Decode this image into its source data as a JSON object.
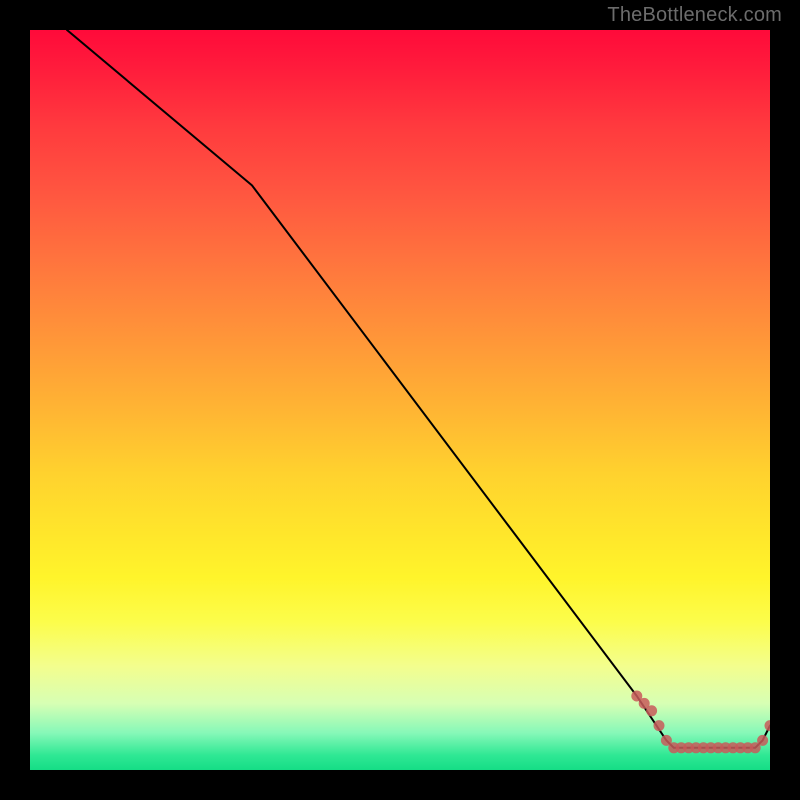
{
  "watermark": "TheBottleneck.com",
  "colors": {
    "bg": "#000000",
    "watermark": "#6c6c6c",
    "line": "#000000",
    "marker": "#c85a5a",
    "gradient_top": "#ff0a3a",
    "gradient_bottom": "#15dd86"
  },
  "chart_data": {
    "type": "line",
    "title": "",
    "xlabel": "",
    "ylabel": "",
    "xlim": [
      0,
      100
    ],
    "ylim": [
      0,
      100
    ],
    "grid": false,
    "legend": false,
    "series": [
      {
        "name": "curve",
        "x": [
          5,
          30,
          82,
          86,
          87,
          88,
          89,
          90,
          91,
          92,
          93,
          94,
          95,
          96,
          97,
          98,
          99,
          100
        ],
        "y": [
          100,
          79,
          10,
          4,
          3,
          3,
          3,
          3,
          3,
          3,
          3,
          3,
          3,
          3,
          3,
          3,
          4,
          6
        ]
      }
    ],
    "markers": {
      "name": "cluster",
      "x": [
        82,
        83,
        84,
        85,
        86,
        87,
        88,
        89,
        90,
        91,
        92,
        93,
        94,
        95,
        96,
        97,
        98,
        99,
        100
      ],
      "y": [
        10,
        9,
        8,
        6,
        4,
        3,
        3,
        3,
        3,
        3,
        3,
        3,
        3,
        3,
        3,
        3,
        3,
        4,
        6
      ]
    }
  }
}
